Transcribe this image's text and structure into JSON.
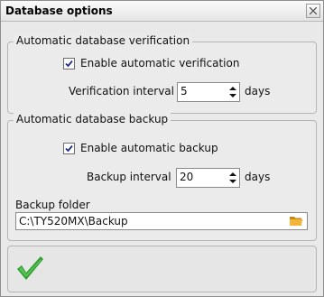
{
  "window": {
    "title": "Database options",
    "close_icon": "close-x-icon"
  },
  "verification": {
    "group_title": "Automatic database verification",
    "enable_label": "Enable automatic verification",
    "enabled": true,
    "interval_label": "Verification interval",
    "interval_value": "5",
    "unit": "days"
  },
  "backup": {
    "group_title": "Automatic database backup",
    "enable_label": "Enable automatic backup",
    "enabled": true,
    "interval_label": "Backup interval",
    "interval_value": "20",
    "unit": "days",
    "folder_label": "Backup folder",
    "folder_value": "C:\\TY520MX\\Backup",
    "folder_icon": "folder-icon"
  },
  "footer": {
    "ok_icon": "checkmark-icon",
    "colors": {
      "checkmark": "#2e9e2e",
      "folder": "#e0a52a"
    }
  }
}
